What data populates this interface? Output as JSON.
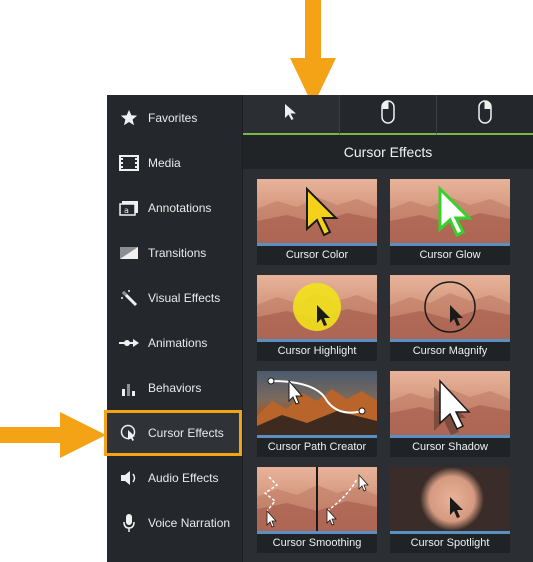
{
  "sidebar": {
    "items": [
      {
        "label": "Favorites",
        "icon": "star-icon"
      },
      {
        "label": "Media",
        "icon": "film-icon"
      },
      {
        "label": "Annotations",
        "icon": "annotation-icon"
      },
      {
        "label": "Transitions",
        "icon": "transition-icon"
      },
      {
        "label": "Visual Effects",
        "icon": "magic-wand-icon"
      },
      {
        "label": "Animations",
        "icon": "animation-arrow-icon"
      },
      {
        "label": "Behaviors",
        "icon": "behaviors-icon"
      },
      {
        "label": "Cursor Effects",
        "icon": "cursor-effects-icon"
      },
      {
        "label": "Audio Effects",
        "icon": "speaker-icon"
      },
      {
        "label": "Voice Narration",
        "icon": "microphone-icon"
      }
    ]
  },
  "tabs": [
    {
      "icon": "cursor-pointer-icon"
    },
    {
      "icon": "left-mouse-click-icon"
    },
    {
      "icon": "right-mouse-click-icon"
    }
  ],
  "panel": {
    "title": "Cursor Effects",
    "effects": [
      {
        "label": "Cursor Color"
      },
      {
        "label": "Cursor Glow"
      },
      {
        "label": "Cursor Highlight"
      },
      {
        "label": "Cursor Magnify"
      },
      {
        "label": "Cursor Path Creator"
      },
      {
        "label": "Cursor Shadow"
      },
      {
        "label": "Cursor Smoothing"
      },
      {
        "label": "Cursor Spotlight"
      }
    ]
  },
  "colors": {
    "annotation_orange": "#f4a317",
    "tab_accent_green": "#7ab648",
    "thumb_underline_blue": "#5a8fc4"
  }
}
